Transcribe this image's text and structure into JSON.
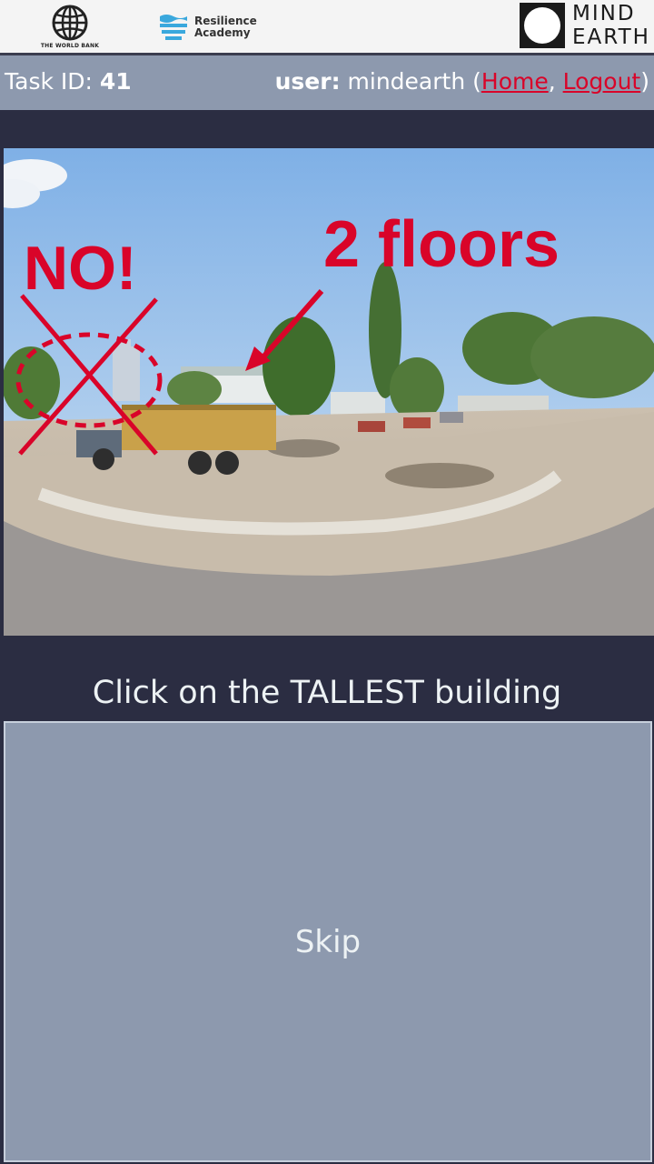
{
  "header": {
    "world_bank_label": "THE WORLD BANK",
    "resilience_line1": "Resilience",
    "resilience_line2": "Academy",
    "mindearth_line1": "MIND",
    "mindearth_line2": "EARTH",
    "icons": [
      "globe-icon",
      "waves-icon",
      "circle-logo-icon"
    ]
  },
  "taskbar": {
    "task_label": "Task ID: ",
    "task_id": "41",
    "user_label": "user:",
    "username": "mindearth",
    "open_paren": "(",
    "home_link": "Home",
    "comma": ", ",
    "logout_link": "Logout",
    "close_paren": ")"
  },
  "image": {
    "annotation_no": "NO!",
    "annotation_floors": "2 floors"
  },
  "instruction": "Click on the TALLEST building",
  "skip_label": "Skip",
  "colors": {
    "background": "#2b2d42",
    "bar": "#8d99ae",
    "accent_red": "#d90429",
    "text_light": "#edf2f4"
  }
}
